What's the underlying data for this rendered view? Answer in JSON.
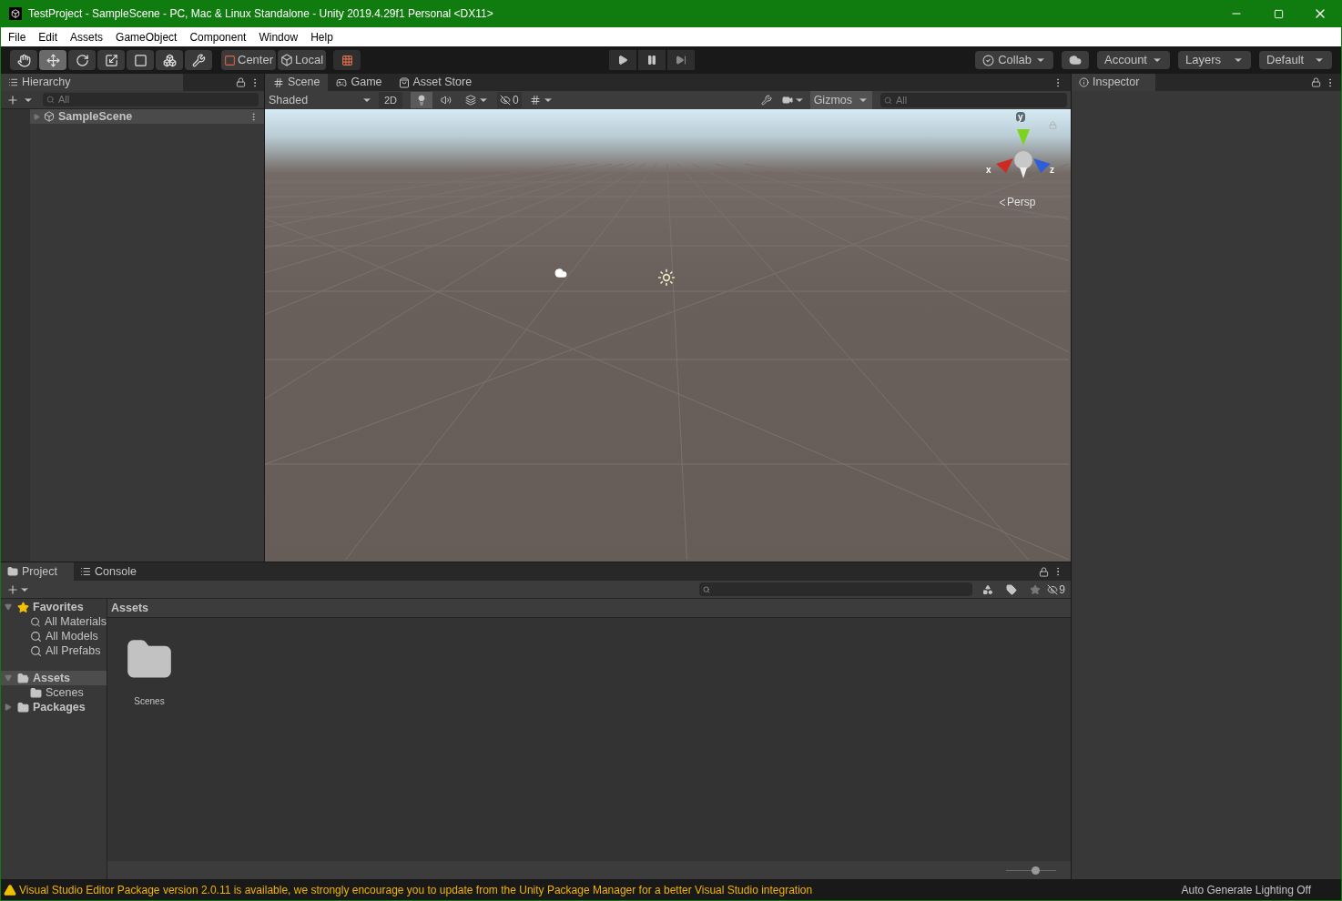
{
  "window": {
    "title": "TestProject - SampleScene - PC, Mac & Linux Standalone - Unity 2019.4.29f1 Personal <DX11>"
  },
  "menu": [
    "File",
    "Edit",
    "Assets",
    "GameObject",
    "Component",
    "Window",
    "Help"
  ],
  "toolbar": {
    "tools": [
      {
        "kind": "hand",
        "selected": false
      },
      {
        "kind": "move",
        "selected": true
      },
      {
        "kind": "rotate",
        "selected": false
      },
      {
        "kind": "scale",
        "selected": false
      },
      {
        "kind": "rect",
        "selected": false
      },
      {
        "kind": "transform",
        "selected": false
      },
      {
        "kind": "custom",
        "selected": false
      }
    ],
    "pivot": [
      "Center",
      "Local"
    ],
    "right": [
      {
        "kind": "collab",
        "label": "Collab"
      },
      {
        "kind": "cloud"
      },
      {
        "kind": "dropdown",
        "label": "Account"
      },
      {
        "kind": "dropdown",
        "label": "Layers"
      },
      {
        "kind": "dropdown",
        "label": "Default"
      }
    ]
  },
  "hierarchy": {
    "tab": "Hierarchy",
    "search_placeholder": "All",
    "items": [
      {
        "label": "SampleScene",
        "selected": false
      }
    ]
  },
  "scene": {
    "tabs": [
      {
        "kind": "scene",
        "label": "Scene",
        "selected": true
      },
      {
        "kind": "game",
        "label": "Game",
        "selected": false
      },
      {
        "kind": "store",
        "label": "Asset Store",
        "selected": false
      }
    ],
    "shading": "Shaded",
    "mode_2d": {
      "label": "2D",
      "on": false
    },
    "lighting_on": true,
    "audio_on": false,
    "effects_on": false,
    "grid_on": false,
    "hidden_count": "0",
    "gizmos": "Gizmos",
    "search_placeholder": "All",
    "axes": [
      "y",
      "x",
      "z"
    ],
    "projection": "Persp"
  },
  "inspector": {
    "tab": "Inspector"
  },
  "project": {
    "tabs": [
      {
        "kind": "project",
        "label": "Project",
        "selected": true
      },
      {
        "kind": "console",
        "label": "Console",
        "selected": false
      }
    ],
    "hidden_count": "9",
    "tree": [
      {
        "kind": "favorites",
        "label": "Favorites",
        "expanded": true,
        "selected": false,
        "children": [
          {
            "kind": "search",
            "label": "All Materials"
          },
          {
            "kind": "search",
            "label": "All Models"
          },
          {
            "kind": "search",
            "label": "All Prefabs"
          }
        ]
      },
      {
        "kind": "folder",
        "label": "Assets",
        "expanded": true,
        "selected": true,
        "children": [
          {
            "kind": "folder",
            "label": "Scenes"
          }
        ]
      },
      {
        "kind": "folder",
        "label": "Packages",
        "expanded": false,
        "selected": false
      }
    ],
    "breadcrumb": "Assets",
    "items": [
      {
        "label": "Scenes"
      }
    ],
    "zoom": {
      "level": 0.58
    }
  },
  "status": {
    "message": "Visual Studio Editor Package version 2.0.11 is available, we strongly encourage you to update from the Unity Package Manager for a better Visual Studio integration",
    "right": "Auto Generate Lighting Off"
  }
}
